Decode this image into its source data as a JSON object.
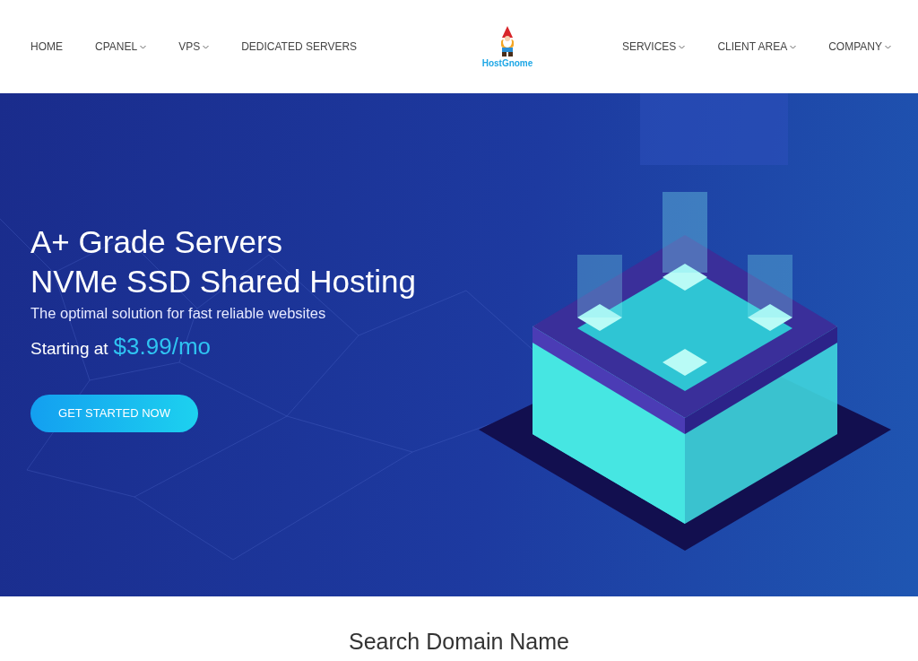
{
  "nav_left": [
    {
      "label": "HOME",
      "dropdown": false
    },
    {
      "label": "CPANEL",
      "dropdown": true
    },
    {
      "label": "VPS",
      "dropdown": true
    },
    {
      "label": "DEDICATED SERVERS",
      "dropdown": false
    }
  ],
  "logo": {
    "text": "HostGnome"
  },
  "nav_right": [
    {
      "label": "SERVICES",
      "dropdown": true
    },
    {
      "label": "CLIENT AREA",
      "dropdown": true
    },
    {
      "label": "COMPANY",
      "dropdown": true
    }
  ],
  "hero": {
    "title_lines": [
      "A+ Grade Servers",
      "NVMe SSD Shared Hosting"
    ],
    "subtitle": "The optimal solution for fast reliable websites",
    "price_prefix": "Starting at",
    "price": "$3.99/mo",
    "button": "GET STARTED NOW"
  },
  "domain_section": {
    "title": "Search Domain Name"
  }
}
